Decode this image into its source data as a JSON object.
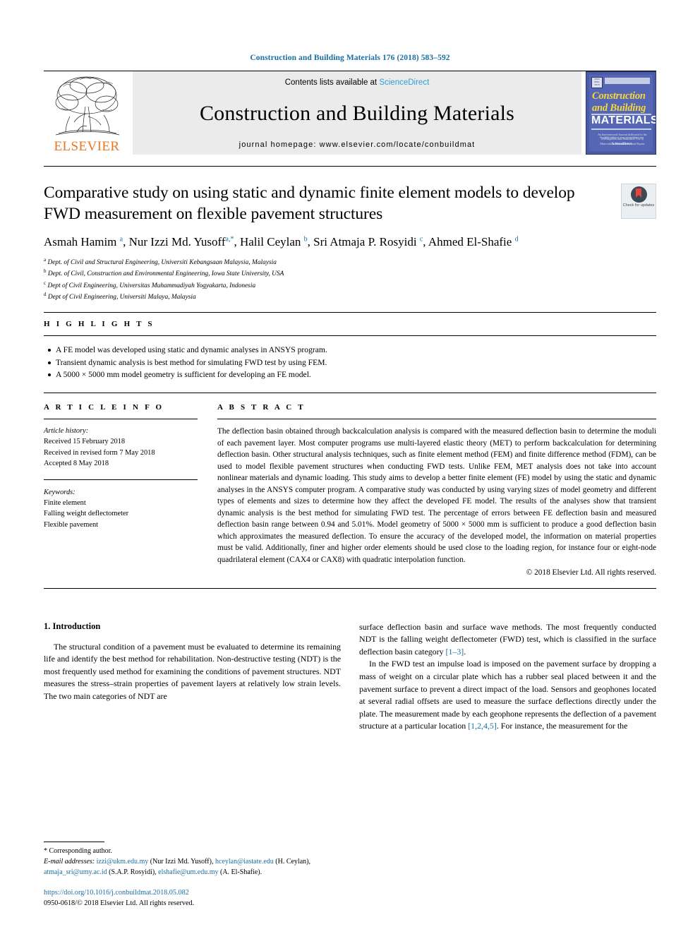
{
  "running_head": "Construction and Building Materials 176 (2018) 583–592",
  "masthead": {
    "publisher": "ELSEVIER",
    "contents_prefix": "Contents lists available at ",
    "contents_link": "ScienceDirect",
    "journal_name": "Construction and Building Materials",
    "homepage": "journal homepage: www.elsevier.com/locate/conbuildmat",
    "cover": {
      "badge": "ISSN 0950-0618",
      "line1": "Construction",
      "line2": "and Building",
      "line3": "MATERIALS",
      "subtitle": "An International Journal dedicated to the Investigation and Innovative Use of Materials in Construction and Repair",
      "footer_small": "Available online at www.sciencedirect.com",
      "footer_brand": "ScienceDirect"
    }
  },
  "article": {
    "title": "Comparative study on using static and dynamic finite element models to develop FWD measurement on flexible pavement structures",
    "crossmark_label": "Check for updates",
    "authors_html": "Asmah Hamim <sup>a</sup>, Nur Izzi Md. Yusoff<sup>a,*</sup>, Halil Ceylan <sup>b</sup>, Sri Atmaja P. Rosyidi <sup>c</sup>, Ahmed El-Shafie <sup>d</sup>",
    "affiliations": [
      {
        "mark": "a",
        "text": "Dept. of Civil and Structural Engineering, Universiti Kebangsaan Malaysia, Malaysia"
      },
      {
        "mark": "b",
        "text": "Dept. of Civil, Construction and Environmental Engineering, Iowa State University, USA"
      },
      {
        "mark": "c",
        "text": "Dept of Civil Engineering, Universitas Muhammadiyah Yogyakarta, Indonesia"
      },
      {
        "mark": "d",
        "text": "Dept of Civil Engineering, Universiti Malaya, Malaysia"
      }
    ]
  },
  "highlights": {
    "heading": "H I G H L I G H T S",
    "items": [
      "A FE model was developed using static and dynamic analyses in ANSYS program.",
      "Transient dynamic analysis is best method for simulating FWD test by using FEM.",
      "A 5000 × 5000 mm model geometry is sufficient for developing an FE model."
    ]
  },
  "article_info": {
    "heading": "A R T I C L E    I N F O",
    "history_label": "Article history:",
    "history": [
      "Received 15 February 2018",
      "Received in revised form 7 May 2018",
      "Accepted 8 May 2018"
    ],
    "keywords_label": "Keywords:",
    "keywords": [
      "Finite element",
      "Falling weight deflectometer",
      "Flexible pavement"
    ]
  },
  "abstract": {
    "heading": "A B S T R A C T",
    "text": "The deflection basin obtained through backcalculation analysis is compared with the measured deflection basin to determine the moduli of each pavement layer. Most computer programs use multi-layered elastic theory (MET) to perform backcalculation for determining deflection basin. Other structural analysis techniques, such as finite element method (FEM) and finite difference method (FDM), can be used to model flexible pavement structures when conducting FWD tests. Unlike FEM, MET analysis does not take into account nonlinear materials and dynamic loading. This study aims to develop a better finite element (FE) model by using the static and dynamic analyses in the ANSYS computer program. A comparative study was conducted by using varying sizes of model geometry and different types of elements and sizes to determine how they affect the developed FE model. The results of the analyses show that transient dynamic analysis is the best method for simulating FWD test. The percentage of errors between FE deflection basin and measured deflection basin range between 0.94 and 5.01%. Model geometry of 5000 × 5000 mm is sufficient to produce a good deflection basin which approximates the measured deflection. To ensure the accuracy of the developed model, the information on material properties must be valid. Additionally, finer and higher order elements should be used close to the loading region, for instance four or eight-node quadrilateral element (CAX4 or CAX8) with quadratic interpolation function.",
    "copyright": "© 2018 Elsevier Ltd. All rights reserved."
  },
  "body": {
    "section_number_title": "1. Introduction",
    "left_paragraph": "The structural condition of a pavement must be evaluated to determine its remaining life and identify the best method for rehabilitation. Non-destructive testing (NDT) is the most frequently used method for examining the conditions of pavement structures. NDT measures the stress–strain properties of pavement layers at relatively low strain levels. The two main categories of NDT are",
    "right_paragraph_1_pre": "surface deflection basin and surface wave methods. The most frequently conducted NDT is the falling weight deflectometer (FWD) test, which is classified in the surface deflection basin category ",
    "right_paragraph_1_ref": "[1–3]",
    "right_paragraph_1_post": ".",
    "right_paragraph_2_pre": "In the FWD test an impulse load is imposed on the pavement surface by dropping a mass of weight on a circular plate which has a rubber seal placed between it and the pavement surface to prevent a direct impact of the load. Sensors and geophones located at several radial offsets are used to measure the surface deflections directly under the plate. The measurement made by each geophone represents the deflection of a pavement structure at a particular location ",
    "right_paragraph_2_ref": "[1,2,4,5]",
    "right_paragraph_2_post": ". For instance, the measurement for the"
  },
  "footnotes": {
    "corresponding_marker": "*",
    "corresponding_text": "Corresponding author.",
    "emails_label": "E-mail addresses:",
    "emails": [
      {
        "addr": "izzi@ukm.edu.my",
        "name": "(Nur Izzi Md. Yusoff)"
      },
      {
        "addr": "hceylan@iastate.edu",
        "name": "(H. Ceylan)"
      },
      {
        "addr": "atmaja_sri@umy.ac.id",
        "name": "(S.A.P. Rosyidi)"
      },
      {
        "addr": "elshafie@um.edu.my",
        "name": "(A. El-Shafie)."
      }
    ],
    "doi": "https://doi.org/10.1016/j.conbuildmat.2018.05.082",
    "issn_line": "0950-0618/© 2018 Elsevier Ltd. All rights reserved."
  },
  "colors": {
    "link": "#1a6fa3",
    "elsevier_orange": "#E87722",
    "sciencedirect": "#2a9fd6",
    "cover_blue": "#4a5ba8",
    "cover_yellow": "#f5d93b"
  }
}
